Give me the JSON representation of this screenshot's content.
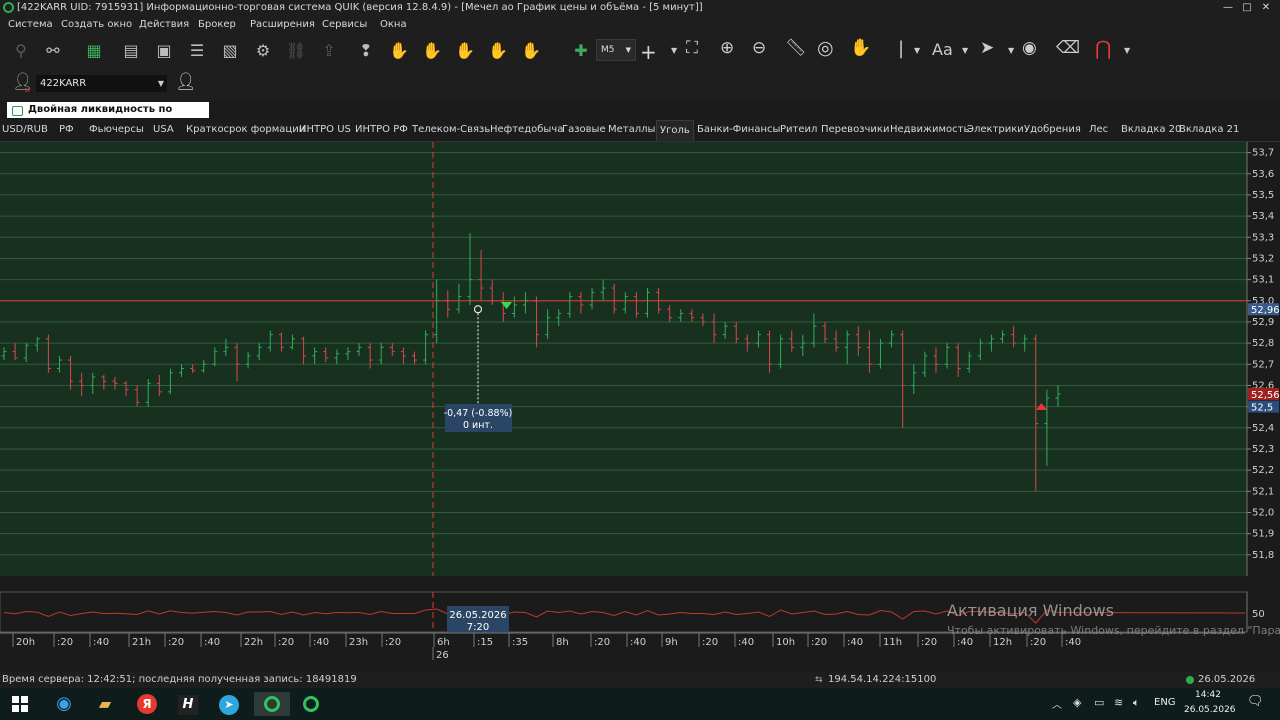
{
  "window": {
    "title": "[422KARR UID: 7915931] Информационно-торговая система QUIK (версия 12.8.4.9) - [Мечел ао График цены и объёма - [5 минут]]",
    "controls": [
      "—",
      "□",
      "✕"
    ]
  },
  "menu": [
    "Система",
    "Создать окно",
    "Действия",
    "Брокер",
    "Расширения",
    "Сервисы",
    "Окна"
  ],
  "toolbar": {
    "timeframe": "M5",
    "font_label": "Aa"
  },
  "account": {
    "code": "422KARR"
  },
  "strategy_label": "Двойная ликвидность по БПИФ...",
  "tabs": [
    {
      "label": "USD/RUB",
      "active": false
    },
    {
      "label": "РФ",
      "active": false
    },
    {
      "label": "Фьючерсы",
      "active": false
    },
    {
      "label": "USA",
      "active": false
    },
    {
      "label": "Краткосрок формации",
      "active": false
    },
    {
      "label": "ИНТРО US",
      "active": false
    },
    {
      "label": "ИНТРО РФ",
      "active": false
    },
    {
      "label": "Телеком-Связь",
      "active": false
    },
    {
      "label": "Нефтедобыча",
      "active": false
    },
    {
      "label": "Газовые",
      "active": false
    },
    {
      "label": "Металлы",
      "active": false
    },
    {
      "label": "Уголь",
      "active": true
    },
    {
      "label": "Банки-Финансы",
      "active": false
    },
    {
      "label": "Ритеил",
      "active": false
    },
    {
      "label": "Перевозчики",
      "active": false
    },
    {
      "label": "Недвижимость",
      "active": false
    },
    {
      "label": "Электрики",
      "active": false
    },
    {
      "label": "Удобрения",
      "active": false
    },
    {
      "label": "Лес",
      "active": false
    },
    {
      "label": "Вкладка 20",
      "active": false
    },
    {
      "label": "Вкладка 21",
      "active": false
    }
  ],
  "chart_data": {
    "type": "bar",
    "ylim": [
      51.7,
      53.75
    ],
    "y_ticks": [
      "53,7",
      "53,6",
      "53,5",
      "53,4",
      "53,3",
      "53,2",
      "53,1",
      "53,0",
      "52,9",
      "52,8",
      "52,7",
      "52,6",
      "52,5",
      "52,4",
      "52,3",
      "52,2",
      "52,1",
      "52,0",
      "51,9",
      "51,8"
    ],
    "price_labels": [
      {
        "text": "52,96",
        "value": 52.96,
        "color": "#3a5a8a"
      },
      {
        "text": "52,56",
        "value": 52.56,
        "color": "#a02020"
      },
      {
        "text": "52,5",
        "value": 52.5,
        "color": "#2a4d7a"
      }
    ],
    "horizontal_line": 53.0,
    "measure": {
      "line1": "-0,47 (-0.88%)",
      "line2": "0 инт."
    },
    "cursor": {
      "date": "26.05.2026",
      "time": "7:20"
    },
    "x_ticks": [
      "20h",
      ":20",
      ":40",
      "21h",
      ":20",
      ":40",
      "22h",
      ":20",
      ":40",
      "23h",
      ":20",
      "6h",
      ":15",
      ":35",
      "8h",
      ":20",
      ":40",
      "9h",
      ":20",
      ":40",
      "10h",
      ":20",
      ":40",
      "11h",
      ":20",
      ":40",
      "12h",
      ":20",
      ":40"
    ],
    "x_day_label": "26",
    "indicator_label": "50",
    "bars": [
      [
        52.74,
        52.78,
        52.72,
        52.76
      ],
      [
        52.76,
        52.8,
        52.72,
        52.73
      ],
      [
        52.73,
        52.8,
        52.71,
        52.79
      ],
      [
        52.79,
        52.83,
        52.76,
        52.82
      ],
      [
        52.82,
        52.84,
        52.66,
        52.68
      ],
      [
        52.68,
        52.74,
        52.66,
        52.72
      ],
      [
        52.72,
        52.74,
        52.58,
        52.62
      ],
      [
        52.62,
        52.66,
        52.55,
        52.6
      ],
      [
        52.6,
        52.66,
        52.56,
        52.64
      ],
      [
        52.64,
        52.65,
        52.58,
        52.62
      ],
      [
        52.62,
        52.64,
        52.58,
        52.61
      ],
      [
        52.61,
        52.62,
        52.55,
        52.58
      ],
      [
        52.58,
        52.6,
        52.5,
        52.52
      ],
      [
        52.52,
        52.63,
        52.5,
        52.61
      ],
      [
        52.61,
        52.65,
        52.55,
        52.57
      ],
      [
        52.57,
        52.68,
        52.56,
        52.66
      ],
      [
        52.66,
        52.7,
        52.64,
        52.68
      ],
      [
        52.68,
        52.7,
        52.66,
        52.67
      ],
      [
        52.67,
        52.72,
        52.66,
        52.7
      ],
      [
        52.7,
        52.78,
        52.69,
        52.76
      ],
      [
        52.76,
        52.82,
        52.74,
        52.78
      ],
      [
        52.78,
        52.8,
        52.62,
        52.7
      ],
      [
        52.7,
        52.76,
        52.68,
        52.74
      ],
      [
        52.74,
        52.8,
        52.72,
        52.78
      ],
      [
        52.78,
        52.86,
        52.76,
        52.84
      ],
      [
        52.84,
        52.85,
        52.76,
        52.78
      ],
      [
        52.78,
        52.84,
        52.77,
        52.82
      ],
      [
        52.82,
        52.83,
        52.7,
        52.74
      ],
      [
        52.74,
        52.78,
        52.7,
        52.76
      ],
      [
        52.76,
        52.78,
        52.71,
        52.73
      ],
      [
        52.73,
        52.77,
        52.7,
        52.75
      ],
      [
        52.75,
        52.78,
        52.72,
        52.76
      ],
      [
        52.76,
        52.8,
        52.74,
        52.78
      ],
      [
        52.78,
        52.8,
        52.68,
        52.72
      ],
      [
        52.72,
        52.8,
        52.7,
        52.78
      ],
      [
        52.78,
        52.8,
        52.74,
        52.76
      ],
      [
        52.76,
        52.78,
        52.7,
        52.74
      ],
      [
        52.74,
        52.76,
        52.7,
        52.72
      ],
      [
        52.72,
        52.86,
        52.7,
        52.84
      ],
      [
        52.84,
        53.1,
        52.8,
        53.0
      ],
      [
        53.0,
        53.05,
        52.92,
        52.96
      ],
      [
        52.96,
        53.08,
        52.94,
        53.02
      ],
      [
        53.02,
        53.32,
        52.98,
        53.1
      ],
      [
        53.1,
        53.24,
        53.0,
        53.06
      ],
      [
        53.06,
        53.1,
        52.98,
        53.0
      ],
      [
        53.0,
        53.04,
        52.9,
        52.94
      ],
      [
        52.94,
        53.02,
        52.92,
        52.98
      ],
      [
        52.98,
        53.04,
        52.94,
        53.0
      ],
      [
        53.0,
        53.02,
        52.78,
        52.84
      ],
      [
        52.84,
        52.96,
        52.82,
        52.92
      ],
      [
        52.92,
        52.96,
        52.88,
        52.94
      ],
      [
        52.94,
        53.04,
        52.92,
        53.02
      ],
      [
        53.02,
        53.04,
        52.94,
        52.98
      ],
      [
        52.98,
        53.06,
        52.96,
        53.04
      ],
      [
        53.04,
        53.1,
        53.0,
        53.06
      ],
      [
        53.06,
        53.08,
        52.94,
        52.96
      ],
      [
        52.96,
        53.04,
        52.94,
        53.02
      ],
      [
        53.02,
        53.04,
        52.92,
        52.94
      ],
      [
        52.94,
        53.06,
        52.92,
        53.04
      ],
      [
        53.04,
        53.06,
        52.94,
        52.96
      ],
      [
        52.96,
        52.98,
        52.9,
        52.92
      ],
      [
        52.92,
        52.96,
        52.9,
        52.94
      ],
      [
        52.94,
        52.96,
        52.9,
        52.92
      ],
      [
        52.92,
        52.94,
        52.88,
        52.9
      ],
      [
        52.9,
        52.94,
        52.8,
        52.84
      ],
      [
        52.84,
        52.9,
        52.82,
        52.88
      ],
      [
        52.88,
        52.9,
        52.8,
        52.82
      ],
      [
        52.82,
        52.84,
        52.76,
        52.8
      ],
      [
        52.8,
        52.86,
        52.78,
        52.84
      ],
      [
        52.84,
        52.86,
        52.66,
        52.7
      ],
      [
        52.7,
        52.84,
        52.68,
        52.82
      ],
      [
        52.82,
        52.86,
        52.76,
        52.78
      ],
      [
        52.78,
        52.84,
        52.74,
        52.8
      ],
      [
        52.8,
        52.94,
        52.78,
        52.88
      ],
      [
        52.88,
        52.9,
        52.8,
        52.82
      ],
      [
        52.82,
        52.86,
        52.76,
        52.78
      ],
      [
        52.78,
        52.86,
        52.7,
        52.84
      ],
      [
        52.84,
        52.88,
        52.74,
        52.78
      ],
      [
        52.78,
        52.86,
        52.66,
        52.7
      ],
      [
        52.7,
        52.82,
        52.68,
        52.8
      ],
      [
        52.8,
        52.86,
        52.78,
        52.84
      ],
      [
        52.84,
        52.86,
        52.4,
        52.6
      ],
      [
        52.6,
        52.7,
        52.56,
        52.66
      ],
      [
        52.66,
        52.76,
        52.64,
        52.74
      ],
      [
        52.74,
        52.78,
        52.66,
        52.7
      ],
      [
        52.7,
        52.8,
        52.68,
        52.78
      ],
      [
        52.78,
        52.8,
        52.64,
        52.68
      ],
      [
        52.68,
        52.76,
        52.66,
        52.74
      ],
      [
        52.74,
        52.82,
        52.72,
        52.8
      ],
      [
        52.8,
        52.84,
        52.76,
        52.82
      ],
      [
        52.82,
        52.86,
        52.8,
        52.84
      ],
      [
        52.84,
        52.88,
        52.78,
        52.8
      ],
      [
        52.8,
        52.84,
        52.76,
        52.82
      ],
      [
        52.82,
        52.84,
        52.1,
        52.42
      ],
      [
        52.42,
        52.58,
        52.22,
        52.54
      ],
      [
        52.54,
        52.6,
        52.5,
        52.56
      ]
    ]
  },
  "status": {
    "server": "Время сервера: 12:42:51; последняя полученная запись: 18491819",
    "connection": "194.54.14.224:15100",
    "date": "26.05.2026"
  },
  "watermark": {
    "title": "Активация Windows",
    "text": "Чтобы активировать Windows, перейдите в раздел \"Параметры\"."
  },
  "taskbar": {
    "lang": "ENG",
    "time": "14:42",
    "date": "26.05.2026"
  }
}
